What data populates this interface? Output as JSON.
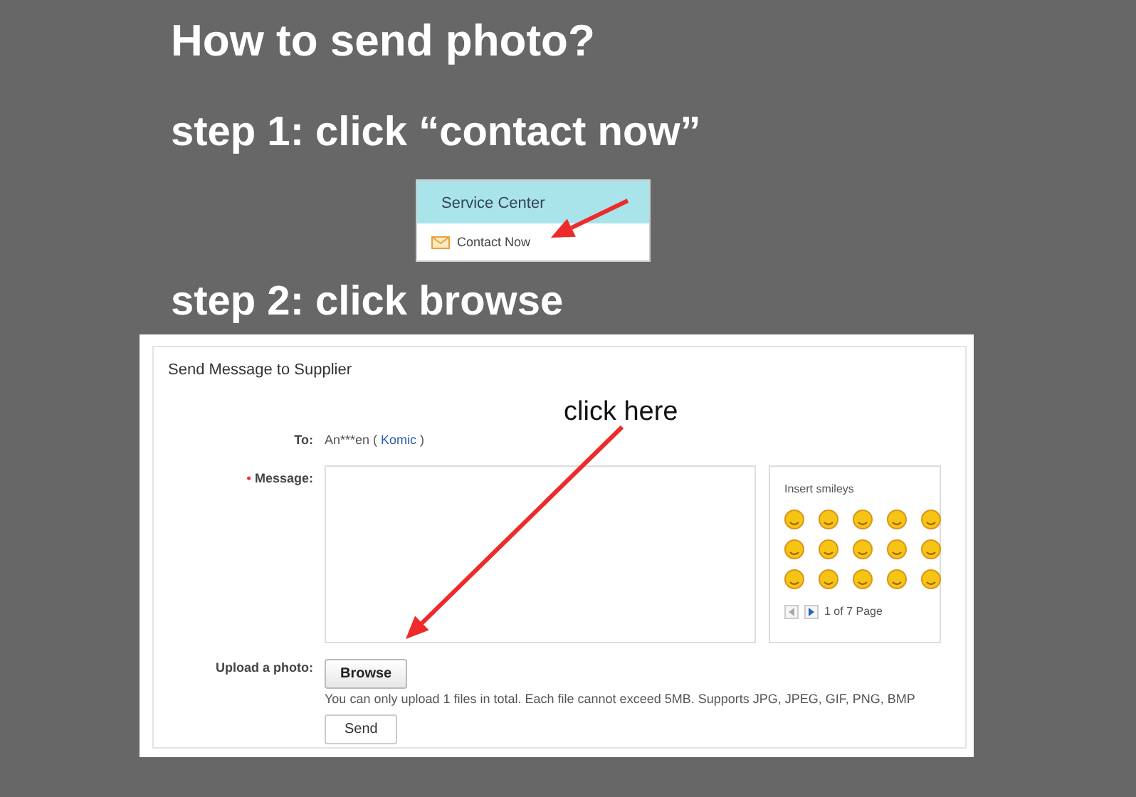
{
  "title": "How to send photo?",
  "steps": [
    {
      "heading": "step 1: click “contact now”"
    },
    {
      "heading": "step 2: click browse"
    }
  ],
  "service_center": {
    "header": "Service Center",
    "item": "Contact Now"
  },
  "form": {
    "title": "Send Message to Supplier",
    "callout": "click here",
    "to": {
      "label": "To:",
      "prefix": "An***en (",
      "link": "Komic",
      "suffix": ")"
    },
    "message": {
      "required_mark": "•",
      "label": "Message:"
    },
    "smileys": {
      "title": "Insert smileys",
      "pager": "1 of 7 Page"
    },
    "upload": {
      "label": "Upload a photo:",
      "button": "Browse",
      "note": "You can only upload 1 files in total. Each file cannot exceed 5MB. Supports JPG, JPEG, GIF, PNG, BMP"
    },
    "send": "Send"
  }
}
